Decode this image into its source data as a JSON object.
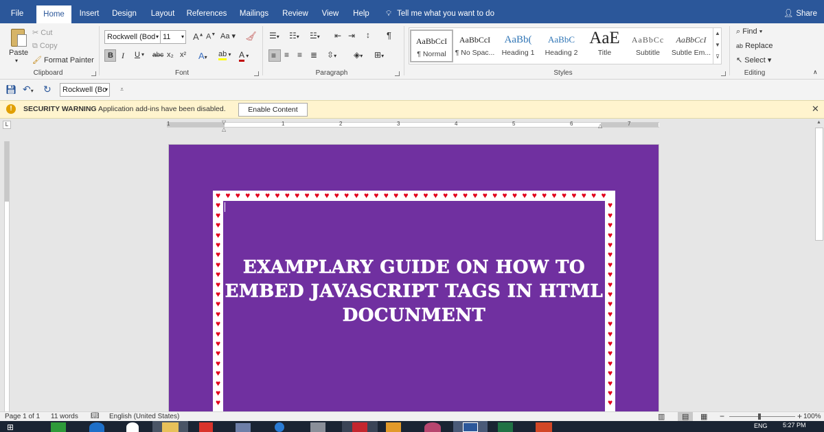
{
  "tabs": [
    "File",
    "Home",
    "Insert",
    "Design",
    "Layout",
    "References",
    "Mailings",
    "Review",
    "View",
    "Help"
  ],
  "active_tab": "Home",
  "tell_me": "Tell me what you want to do",
  "share": "Share",
  "clipboard": {
    "paste": "Paste",
    "cut": "Cut",
    "copy": "Copy",
    "format_painter": "Format Painter",
    "label": "Clipboard"
  },
  "font": {
    "name": "Rockwell (Bod",
    "size": "11",
    "label": "Font",
    "change_case": "Aa",
    "bold": "B",
    "italic": "I",
    "underline": "U",
    "strike": "abc",
    "subscript": "x₂",
    "superscript": "x²",
    "font_color": "A"
  },
  "paragraph": {
    "label": "Paragraph",
    "pilcrow": "¶"
  },
  "styles": {
    "label": "Styles",
    "items": [
      {
        "preview": "AaBbCcI",
        "name": "¶ Normal"
      },
      {
        "preview": "AaBbCcI",
        "name": "¶ No Spac..."
      },
      {
        "preview": "AaBb(",
        "name": "Heading 1"
      },
      {
        "preview": "AaBbC",
        "name": "Heading 2"
      },
      {
        "preview": "AaE",
        "name": "Title"
      },
      {
        "preview": "AaBbCc",
        "name": "Subtitle"
      },
      {
        "preview": "AaBbCcI",
        "name": "Subtle Em..."
      }
    ],
    "heading_color": "#2e74b5",
    "subtle_color": "#595959"
  },
  "editing": {
    "find": "Find",
    "replace": "Replace",
    "select": "Select",
    "label": "Editing"
  },
  "qat": {
    "font_box": "Rockwell (Bo"
  },
  "security": {
    "title": "SECURITY WARNING",
    "message": "Application add-ins have been disabled.",
    "button": "Enable Content"
  },
  "ruler": {
    "numbers": [
      "1",
      "1",
      "2",
      "3",
      "4",
      "5",
      "6",
      "7"
    ]
  },
  "document": {
    "title_lines": [
      "EXAMPLARY GUIDE ON HOW TO",
      "EMBED JAVASCRIPT TAGS IN HTML",
      "DOCUNMENT"
    ],
    "page_color": "#7030a0",
    "heart_color": "#e3001b"
  },
  "status": {
    "page": "Page 1 of 1",
    "words": "11 words",
    "language": "English (United States)",
    "zoom": "100%"
  },
  "taskbar": {
    "lang": "ENG",
    "time": "5:27 PM"
  },
  "colors": {
    "ribbon_blue": "#2b579a",
    "warning_bg": "#fff4ce"
  }
}
